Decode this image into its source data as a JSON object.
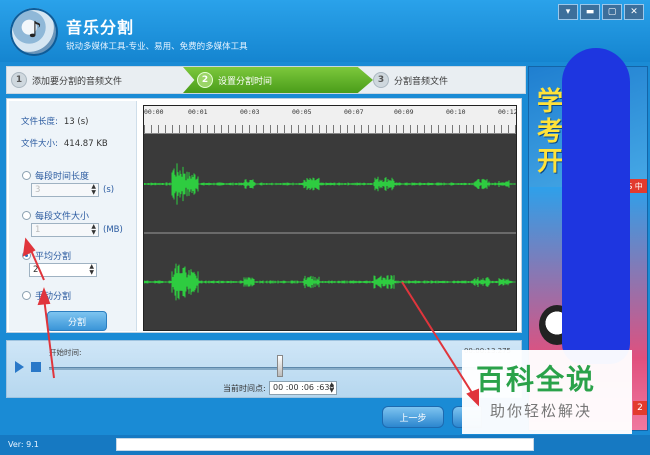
{
  "app": {
    "title": "音乐分割",
    "subtitle": "锐动多媒体工具-专业、易用、免费的多媒体工具",
    "version": "Ver: 9.1"
  },
  "window_controls": {
    "menu": "▾",
    "minimize": "▬",
    "maximize": "▢",
    "close": "✕"
  },
  "steps": [
    {
      "num": "1",
      "label": "添加要分割的音频文件"
    },
    {
      "num": "2",
      "label": "设置分割时间"
    },
    {
      "num": "3",
      "label": "分割音频文件"
    }
  ],
  "file_info": {
    "length_label": "文件长度:",
    "length_value": "13 (s)",
    "size_label": "文件大小:",
    "size_value": "414.87 KB"
  },
  "options": {
    "by_time": {
      "label": "每段时间长度",
      "value": "3",
      "unit": "(s)",
      "selected": false
    },
    "by_size": {
      "label": "每段文件大小",
      "value": "1",
      "unit": "(MB)",
      "selected": false
    },
    "average": {
      "label": "平均分割",
      "value": "2",
      "selected": true
    },
    "manual": {
      "label": "手动分割",
      "selected": false
    }
  },
  "split_button": "分割",
  "ruler_ticks": [
    "00:00",
    "00:01",
    "00:03",
    "00:05",
    "00:07",
    "00:09",
    "00:10",
    "00:12"
  ],
  "transport": {
    "start_label": "开始时间:",
    "end_label": "00:00:13.275",
    "current_label": "当前时间点:",
    "current_value": "00 :00 :06 :638"
  },
  "nav": {
    "prev": "上一步"
  },
  "watermark": {
    "big": "百科全说",
    "small": "助你轻松解决"
  },
  "ad": {
    "letters": "学\n考\n开",
    "badge": "S 中",
    "number": "2"
  },
  "colors": {
    "accent": "#1a8bd5",
    "wave": "#2ecc40",
    "step_active": "#5bb027"
  },
  "icons": {
    "play": "play-icon",
    "stop": "stop-icon"
  }
}
